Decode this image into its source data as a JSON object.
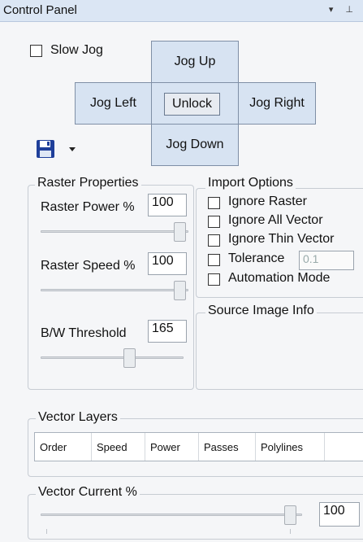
{
  "window": {
    "title": "Control Panel",
    "titlebar_icons": "▾ ⊥"
  },
  "jog": {
    "slow_jog_label": "Slow Jog",
    "up": "Jog Up",
    "left": "Jog Left",
    "unlock": "Unlock",
    "right": "Jog Right",
    "down": "Jog Down"
  },
  "toolbar": {
    "save_icon": "floppy-disk-icon",
    "dropdown_icon": "chevron-down-icon"
  },
  "raster": {
    "legend": "Raster Properties",
    "power_label": "Raster Power %",
    "power_value": "100",
    "power_level": 1.0,
    "speed_label": "Raster Speed %",
    "speed_value": "100",
    "speed_level": 1.0,
    "threshold_label": "B/W Threshold",
    "threshold_value": "165",
    "threshold_level": 0.65
  },
  "import": {
    "legend": "Import Options",
    "ignore_raster": "Ignore Raster",
    "ignore_all_vector": "Ignore All Vector",
    "ignore_thin_vector": "Ignore Thin Vector",
    "tolerance": "Tolerance",
    "tolerance_value": "0.1",
    "automation_mode": "Automation Mode"
  },
  "source": {
    "legend": "Source Image Info"
  },
  "vector_layers": {
    "legend": "Vector Layers",
    "columns": [
      "Order",
      "Speed",
      "Power",
      "Passes",
      "Polylines"
    ]
  },
  "vector_current": {
    "legend": "Vector Current %",
    "value": "100",
    "level": 1.0
  },
  "colors": {
    "button_bg": "#d7e3f2",
    "titlebar_bg": "#dbe6f4",
    "save_icon": "#1f3f9a"
  }
}
